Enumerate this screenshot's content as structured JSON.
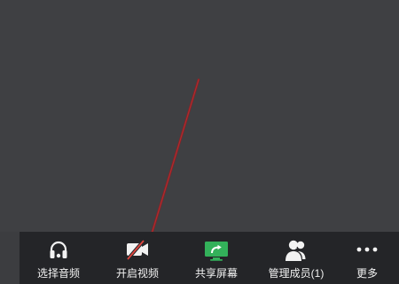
{
  "toolbar": {
    "items": [
      {
        "label": "选择音频",
        "icon": "headphones-icon"
      },
      {
        "label": "开启视频",
        "icon": "video-off-icon"
      },
      {
        "label": "共享屏幕",
        "icon": "share-screen-icon"
      },
      {
        "label": "管理成员(1)",
        "icon": "members-icon"
      },
      {
        "label": "更多",
        "icon": "more-icon"
      }
    ]
  },
  "colors": {
    "background": "#3f4043",
    "toolbar": "#242528",
    "text": "#f2f2f2",
    "accent": "#33b15a",
    "annotation": "#8d1f24"
  }
}
